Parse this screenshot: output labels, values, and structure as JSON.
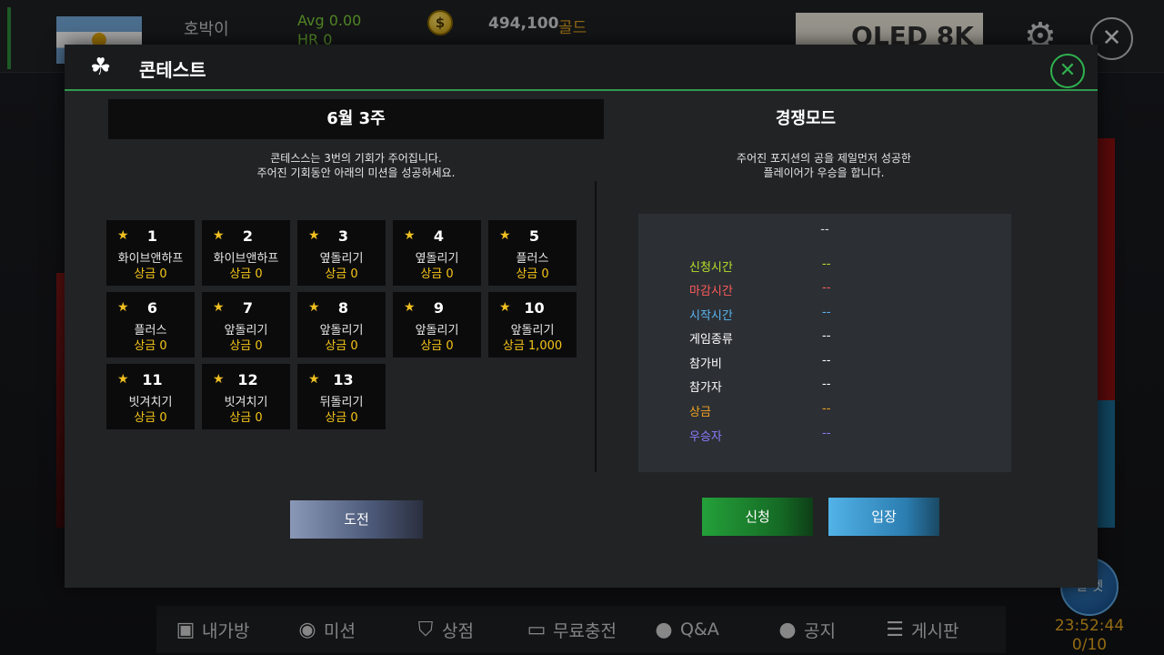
{
  "background": {
    "player_name": "호박이",
    "avg": "Avg 0.00",
    "hr": "HR 0",
    "coin_symbol": "$",
    "gold_amount": "494,100",
    "gold_unit": "골드",
    "ad_text": "QLED 8K",
    "settings_icon": "gear-icon",
    "close_icon": "close-icon",
    "chat_label": "일 젯"
  },
  "modal": {
    "title": "콘테스트",
    "title_icon": "clover-icon",
    "close_symbol": "✕",
    "left": {
      "heading": "6월 3주",
      "desc_line1": "콘테스스는 3번의 기회가 주어집니다.",
      "desc_line2": "주어진 기회동안 아래의 미션을 성공하세요.",
      "missions": [
        {
          "num": "1",
          "name": "화이브앤하프",
          "reward": "상금 0"
        },
        {
          "num": "2",
          "name": "화이브앤하프",
          "reward": "상금 0"
        },
        {
          "num": "3",
          "name": "옆돌리기",
          "reward": "상금 0"
        },
        {
          "num": "4",
          "name": "옆돌리기",
          "reward": "상금 0"
        },
        {
          "num": "5",
          "name": "플러스",
          "reward": "상금 0"
        },
        {
          "num": "6",
          "name": "플러스",
          "reward": "상금 0"
        },
        {
          "num": "7",
          "name": "앞돌리기",
          "reward": "상금 0"
        },
        {
          "num": "8",
          "name": "앞돌리기",
          "reward": "상금 0"
        },
        {
          "num": "9",
          "name": "앞돌리기",
          "reward": "상금 0"
        },
        {
          "num": "10",
          "name": "앞돌리기",
          "reward": "상금 1,000"
        },
        {
          "num": "11",
          "name": "빗겨치기",
          "reward": "상금 0"
        },
        {
          "num": "12",
          "name": "빗겨치기",
          "reward": "상금 0"
        },
        {
          "num": "13",
          "name": "뒤돌리기",
          "reward": "상금 0"
        }
      ],
      "challenge_button": "도전"
    },
    "right": {
      "heading": "경쟁모드",
      "desc_line1": "주어진 포지션의 공을 제일먼저 성공한",
      "desc_line2": "플레이어가 우승을 합니다.",
      "info_title": "--",
      "rows": [
        {
          "label": "신청시간",
          "value": "--",
          "color": "#b8e02a"
        },
        {
          "label": "마감시간",
          "value": "--",
          "color": "#ff5a5a"
        },
        {
          "label": "시작시간",
          "value": "--",
          "color": "#5ab4f0"
        },
        {
          "label": "게임종류",
          "value": "--",
          "color": "#ffffff"
        },
        {
          "label": "참가비",
          "value": "--",
          "color": "#ffffff"
        },
        {
          "label": "참가자",
          "value": "--",
          "color": "#ffffff"
        },
        {
          "label": "상금",
          "value": "--",
          "color": "#f0a020"
        },
        {
          "label": "우승자",
          "value": "--",
          "color": "#8c7cff"
        }
      ],
      "apply_button": "신청",
      "enter_button": "입장"
    }
  },
  "bottom_nav": [
    {
      "label": "내가방",
      "icon": "bag-icon"
    },
    {
      "label": "미션",
      "icon": "target-icon"
    },
    {
      "label": "상점",
      "icon": "basket-icon"
    },
    {
      "label": "무료충전",
      "icon": "battery-icon"
    },
    {
      "label": "Q&A",
      "icon": "chat-bubble-icon"
    },
    {
      "label": "공지",
      "icon": "speech-icon"
    },
    {
      "label": "게시판",
      "icon": "list-icon"
    }
  ],
  "clock": {
    "time": "23:52:44",
    "count": "0/10"
  }
}
